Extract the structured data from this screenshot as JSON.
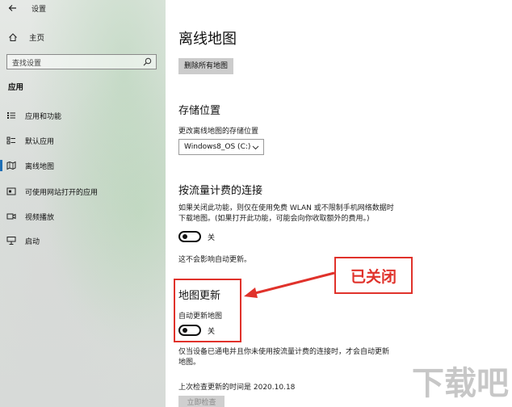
{
  "window": {
    "title": "设置"
  },
  "sidebar": {
    "home_label": "主页",
    "search_placeholder": "查找设置",
    "section_title": "应用",
    "items": [
      {
        "label": "应用和功能",
        "icon": "apps-list-icon"
      },
      {
        "label": "默认应用",
        "icon": "default-apps-icon"
      },
      {
        "label": "离线地图",
        "icon": "offline-map-icon",
        "active": true
      },
      {
        "label": "可使用网站打开的应用",
        "icon": "open-in-app-icon"
      },
      {
        "label": "视频播放",
        "icon": "video-icon"
      },
      {
        "label": "启动",
        "icon": "startup-icon"
      }
    ]
  },
  "main": {
    "page_title": "离线地图",
    "delete_all_button": "删除所有地图",
    "storage": {
      "title": "存储位置",
      "label": "更改离线地图的存储位置",
      "selected_drive": "Windows8_OS (C:)"
    },
    "metered": {
      "title": "按流量计费的连接",
      "description_line1": "如果关闭此功能，则仅在使用免费 WLAN 或不限制手机网络数据时",
      "description_line2": "下载地图。(如果打开此功能，可能会向你收取额外的费用。)",
      "toggle_state": "关",
      "note": "这不会影响自动更新。"
    },
    "map_updates": {
      "title": "地图更新",
      "auto_update_label": "自动更新地图",
      "toggle_state": "关",
      "description_line1": "仅当设备已通电并且你未使用按流量计费的连接时，才会自动更新",
      "description_line2": "地图。",
      "last_checked": "上次检查更新的时间是 2020.10.18",
      "check_now_button": "立即检查"
    }
  },
  "annotation": {
    "callout_text": "已关闭",
    "accent": "#e0322b"
  },
  "watermark": {
    "text": "下载吧"
  },
  "colors": {
    "nav_accent": "#1f6fb5",
    "button_bg": "#cccccc"
  }
}
